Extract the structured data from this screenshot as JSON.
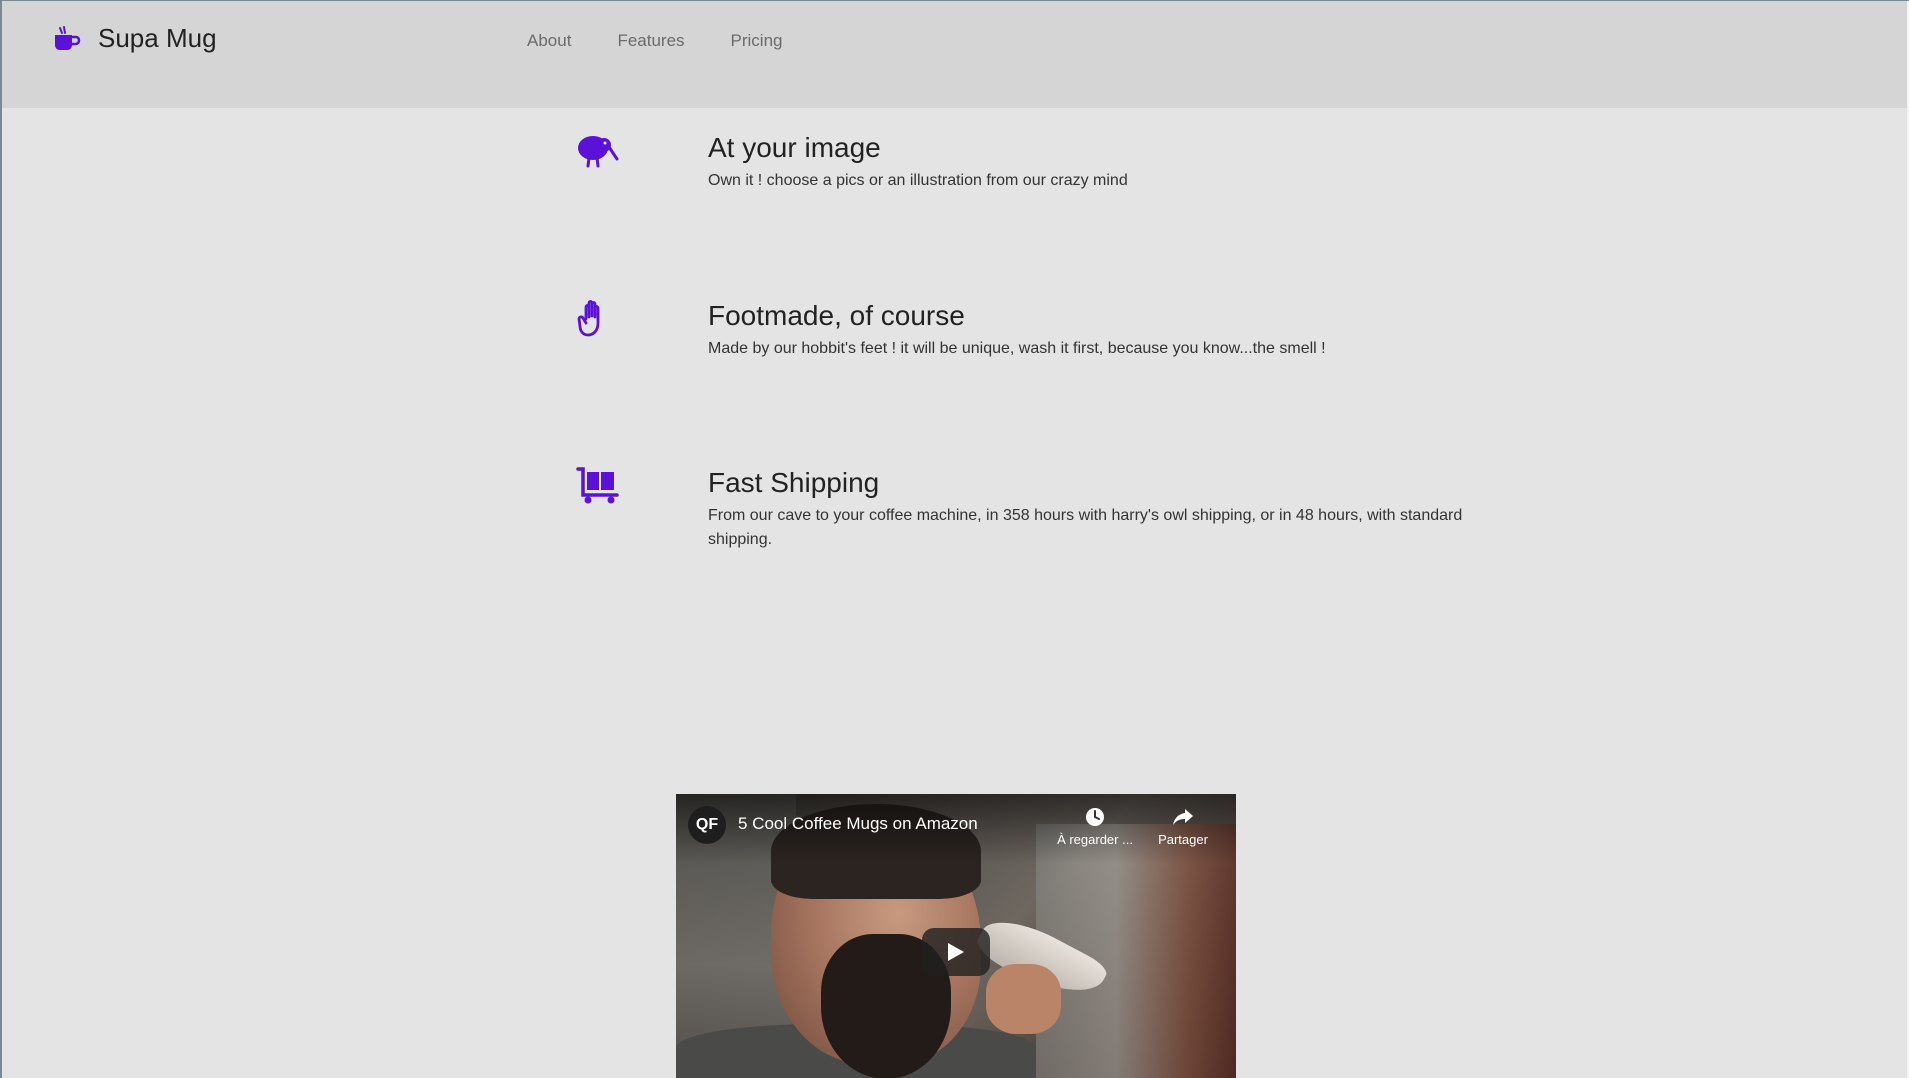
{
  "brand": {
    "name": "Supa Mug",
    "icon": "coffee-mug-icon",
    "accent_color": "#5b11d8"
  },
  "nav": {
    "links": [
      {
        "label": "About"
      },
      {
        "label": "Features"
      },
      {
        "label": "Pricing"
      }
    ]
  },
  "features": [
    {
      "icon": "kiwi-bird-icon",
      "title": "At your image",
      "description": "Own it ! choose a pics or an illustration from our crazy mind"
    },
    {
      "icon": "hand-icon",
      "title": "Footmade, of course",
      "description": "Made by our hobbit's feet ! it will be unique, wash it first, because you know...the smell !"
    },
    {
      "icon": "shipping-dolly-icon",
      "title": "Fast Shipping",
      "description": "From our cave to your coffee machine, in 358 hours with harry's owl shipping, or in 48 hours, with standard shipping."
    }
  ],
  "video": {
    "channel_logo": "QF",
    "title": "5 Cool Coffee Mugs on Amazon",
    "watch_later_label": "À regarder ...",
    "share_label": "Partager"
  }
}
